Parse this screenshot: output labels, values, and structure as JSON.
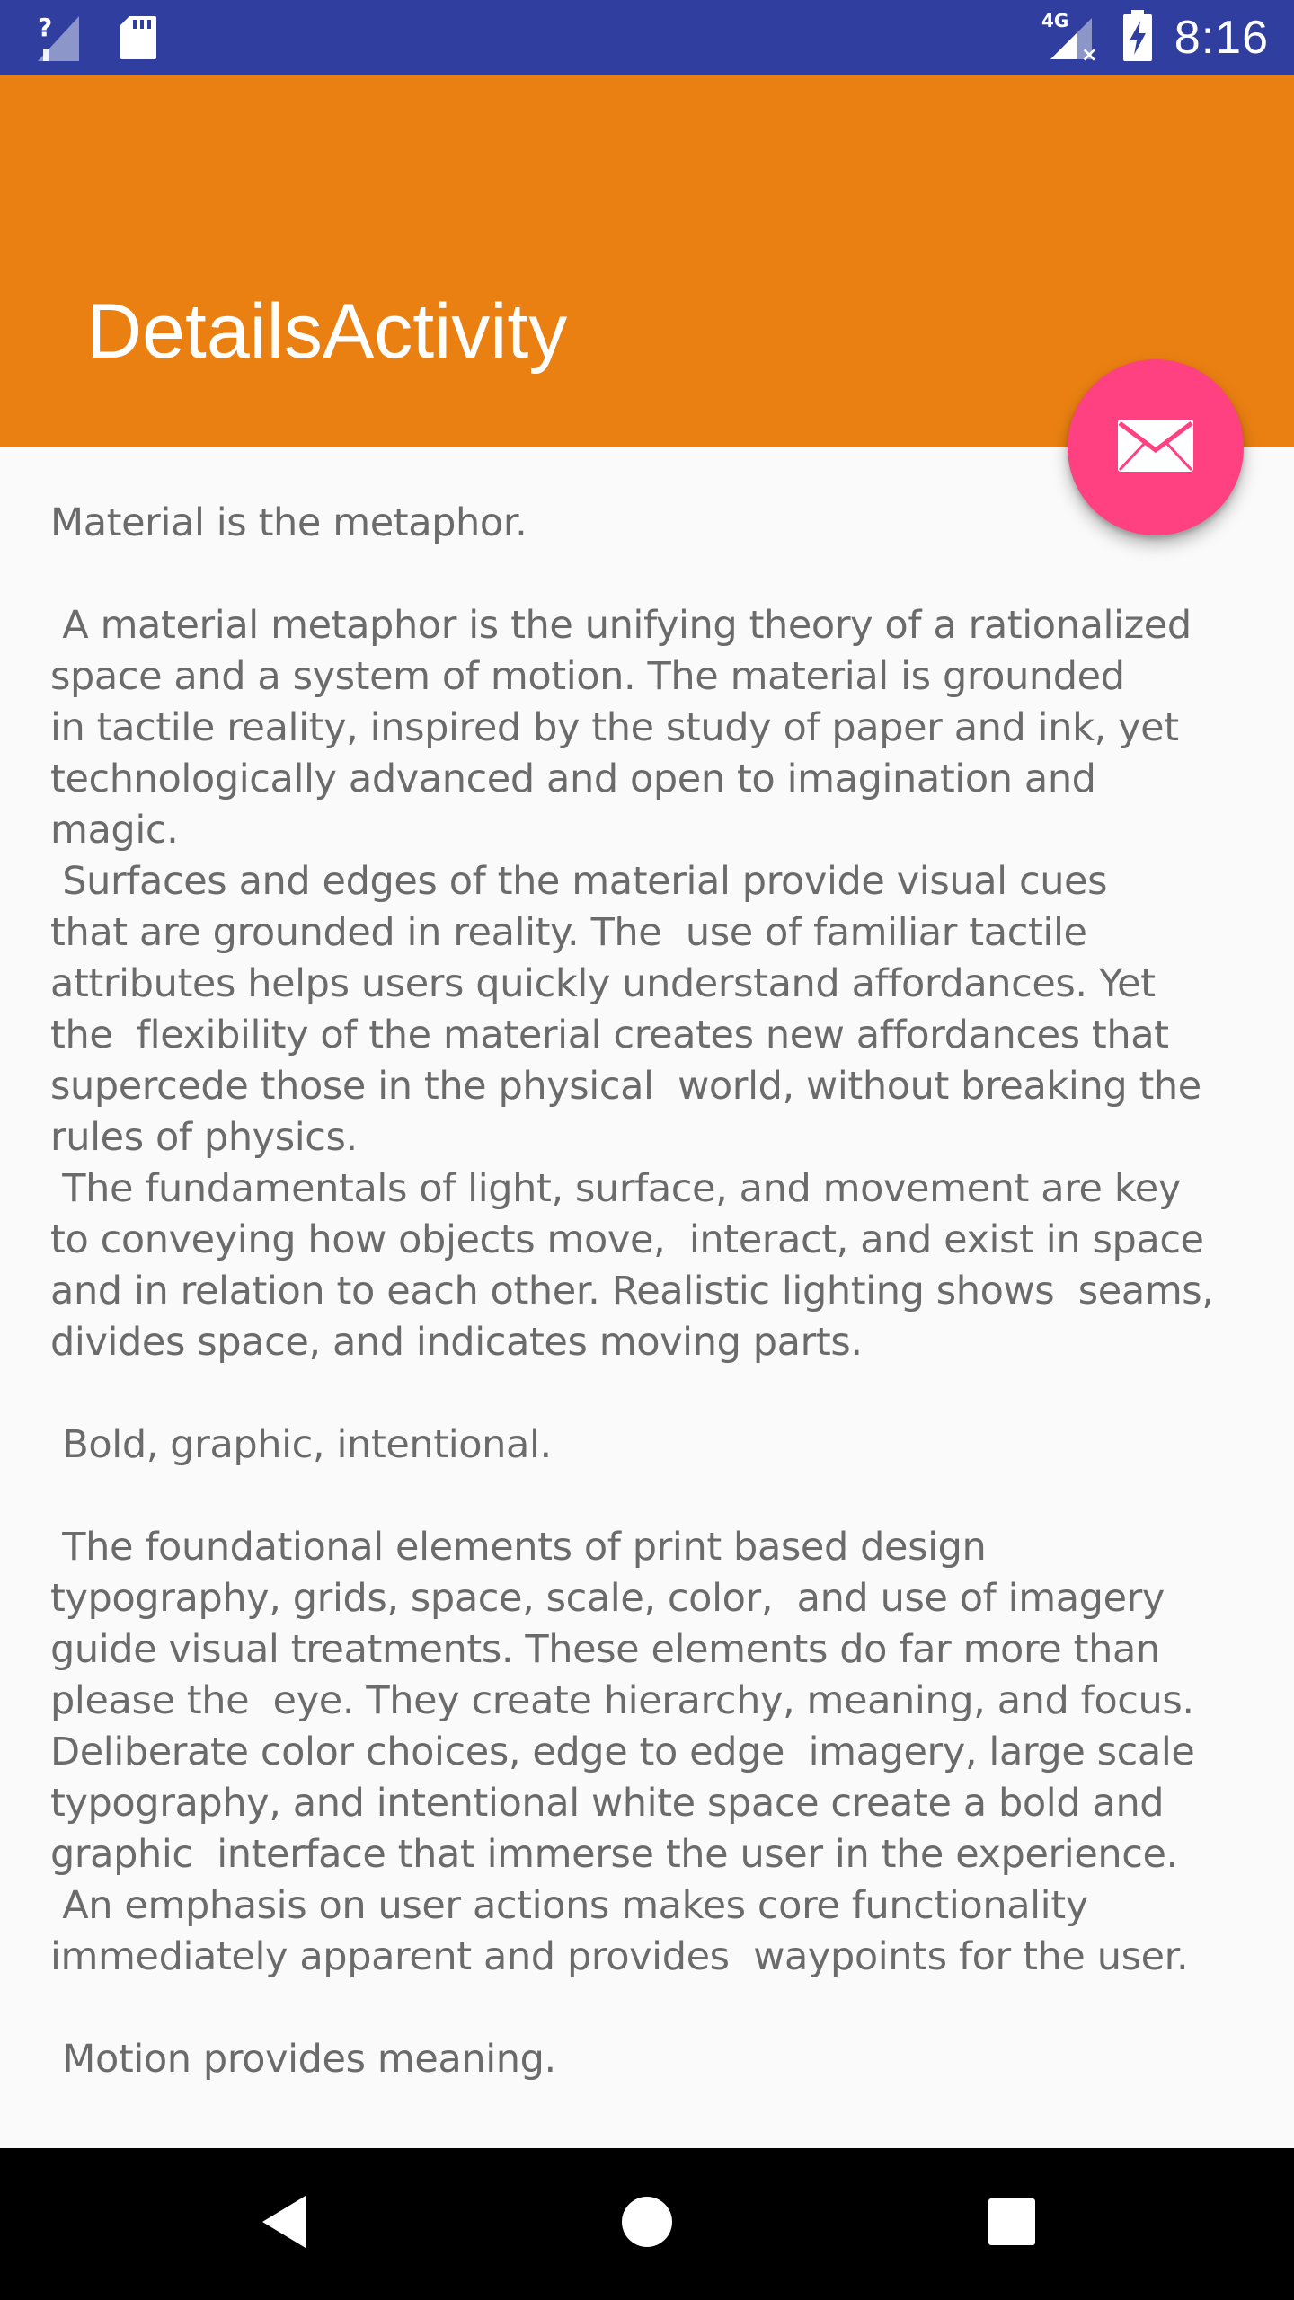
{
  "status_bar": {
    "time": "8:16",
    "network_type": "4G",
    "icons": [
      "no-signal-icon",
      "sd-card-icon",
      "mobile-data-icon",
      "battery-charging-icon"
    ]
  },
  "app_bar": {
    "title": "DetailsActivity",
    "color": "#ea8012"
  },
  "fab": {
    "icon": "email-icon",
    "color": "#ff4081"
  },
  "content": {
    "text": "Material is the metaphor.\n\n A material metaphor is the unifying theory of a rationalized\nspace and a system of motion. The material is grounded\nin tactile reality, inspired by the study of paper and ink, yet\ntechnologically advanced and open to imagination and\nmagic.\n Surfaces and edges of the material provide visual cues\nthat are grounded in reality. The  use of familiar tactile\nattributes helps users quickly understand affordances. Yet\nthe  flexibility of the material creates new affordances that\nsupercede those in the physical  world, without breaking the\nrules of physics.\n The fundamentals of light, surface, and movement are key\nto conveying how objects move,  interact, and exist in space\nand in relation to each other. Realistic lighting shows  seams,\ndivides space, and indicates moving parts.\n\n Bold, graphic, intentional.\n\n The foundational elements of print based design\ntypography, grids, space, scale, color,  and use of imagery\nguide visual treatments. These elements do far more than\nplease the  eye. They create hierarchy, meaning, and focus.\nDeliberate color choices, edge to edge  imagery, large scale\ntypography, and intentional white space create a bold and\ngraphic  interface that immerse the user in the experience.\n An emphasis on user actions makes core functionality\nimmediately apparent and provides  waypoints for the user.\n\n Motion provides meaning."
  },
  "nav_bar": {
    "buttons": [
      "back-icon",
      "home-icon",
      "recents-icon"
    ]
  }
}
